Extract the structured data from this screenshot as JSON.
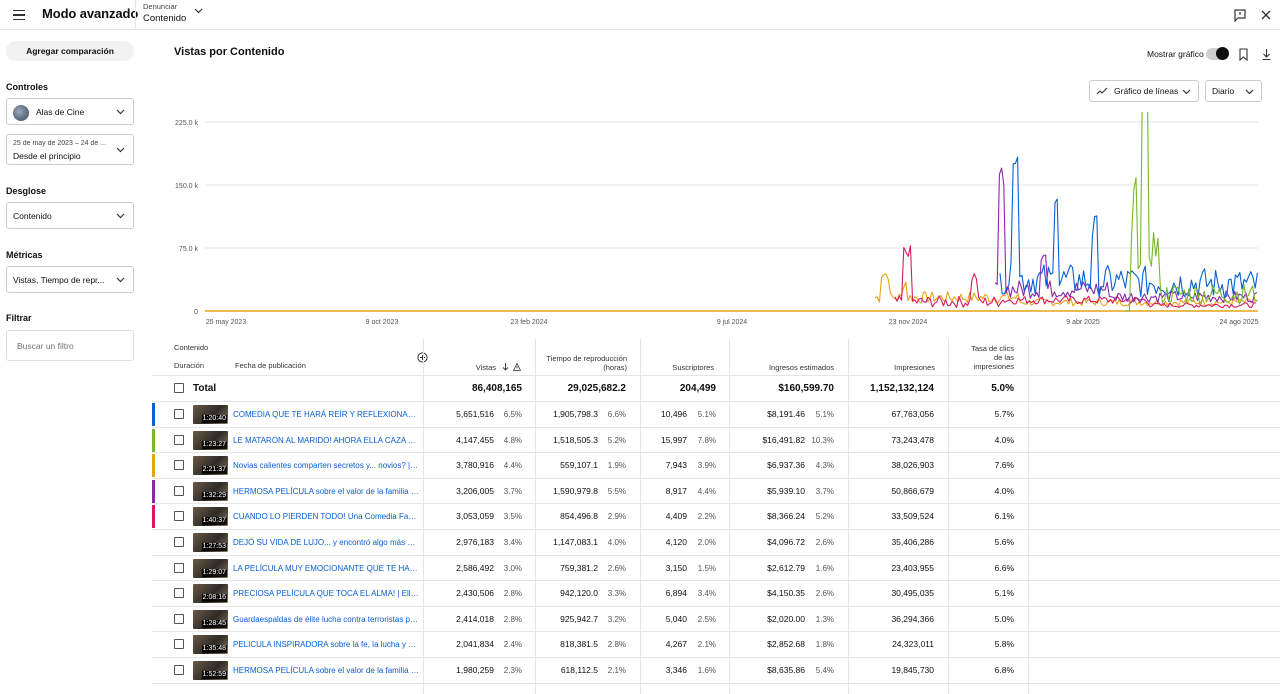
{
  "header": {
    "title": "Modo avanzado",
    "report_label": "Denunciar",
    "report_value": "Contenido"
  },
  "sidebar": {
    "add_comparison": "Agregar comparación",
    "controls_label": "Controles",
    "channel": "Alas de Cine",
    "date_range_top": "25 de may de 2023 – 24 de ...",
    "date_range": "Desde el principio",
    "breakdown_label": "Desglose",
    "breakdown_value": "Contenido",
    "metrics_label": "Métricas",
    "metrics_value": "Vistas, Tiempo de repr...",
    "filter_label": "Filtrar",
    "filter_placeholder": "Buscar un filtro"
  },
  "chart": {
    "title": "Vistas por Contenido",
    "show_graph_label": "Mostrar gráfico",
    "chart_type_label": "Gráfico de líneas",
    "granularity_label": "Diario"
  },
  "chart_data": {
    "type": "line",
    "x_ticks": [
      "25 may 2023",
      "9 oct 2023",
      "23 feb 2024",
      "9 jul 2024",
      "23 nov 2024",
      "9 abr 2025",
      "24 ago 2025"
    ],
    "y_ticks": [
      "0",
      "75.0 k",
      "150.0 k",
      "225.0 k"
    ],
    "ylim": [
      0,
      225000
    ],
    "series_colors": [
      "#065fd4",
      "#76b82a",
      "#e8a317",
      "#8e24aa",
      "#d81b60",
      "#ff8f00"
    ]
  },
  "table": {
    "headers": {
      "content": "Contenido",
      "duration": "Duración",
      "publish_date": "Fecha de publicación",
      "views": "Vistas",
      "watch_time": "Tiempo de reproducción (horas)",
      "subscribers": "Suscriptores",
      "revenue": "Ingresos estimados",
      "impressions": "Impresiones",
      "ctr": "Tasa de clics de las impresiones"
    },
    "total": {
      "label": "Total",
      "views": "86,408,165",
      "watch": "29,025,682.2",
      "subs": "204,499",
      "revenue": "$160,599.70",
      "impr": "1,152,132,124",
      "ctr": "5.0%"
    },
    "rows": [
      {
        "color": "#065fd4",
        "dur": "1:20:40",
        "title": "COMEDIA QUE TE HARÁ REÍR Y REFLEXIONAR ¿Segun...",
        "views": "5,651,516",
        "views_pct": "6.5%",
        "watch": "1,905,798.3",
        "watch_pct": "6.6%",
        "subs": "10,496",
        "subs_pct": "5.1%",
        "rev": "$8,191.46",
        "rev_pct": "5.1%",
        "impr": "67,763,056",
        "ctr": "5.7%"
      },
      {
        "color": "#76b82a",
        "dur": "1:23:27",
        "title": "LE MATARON AL MARIDO! AHORA ELLA CAZA A LOS ...",
        "views": "4,147,455",
        "views_pct": "4.8%",
        "watch": "1,518,505.3",
        "watch_pct": "5.2%",
        "subs": "15,997",
        "subs_pct": "7.8%",
        "rev": "$16,491.82",
        "rev_pct": "10.3%",
        "impr": "73,243,478",
        "ctr": "4.0%"
      },
      {
        "color": "#e8a317",
        "dur": "2:21:37",
        "title": "Novias calientes comparten secretos y... novios? | Peli...",
        "views": "3,780,916",
        "views_pct": "4.4%",
        "watch": "559,107.1",
        "watch_pct": "1.9%",
        "subs": "7,943",
        "subs_pct": "3.9%",
        "rev": "$6,937.36",
        "rev_pct": "4.3%",
        "impr": "38,026,903",
        "ctr": "7.6%"
      },
      {
        "color": "#8e24aa",
        "dur": "1:32:29",
        "title": "HERMOSA PELÍCULA sobre el valor de la familia y el p...",
        "views": "3,206,005",
        "views_pct": "3.7%",
        "watch": "1,590,979.8",
        "watch_pct": "5.5%",
        "subs": "8,917",
        "subs_pct": "4.4%",
        "rev": "$5,939.10",
        "rev_pct": "3.7%",
        "impr": "50,866,679",
        "ctr": "4.0%"
      },
      {
        "color": "#d81b60",
        "dur": "1:40:37",
        "title": "CUANDO LO PIERDEN TODO! Una Comedia Familiar pa...",
        "views": "3,053,059",
        "views_pct": "3.5%",
        "watch": "854,496.8",
        "watch_pct": "2.9%",
        "subs": "4,409",
        "subs_pct": "2.2%",
        "rev": "$8,366.24",
        "rev_pct": "5.2%",
        "impr": "33,509,524",
        "ctr": "6.1%"
      },
      {
        "color": "",
        "dur": "1:27:53",
        "title": "DEJÓ SU VIDA DE LUJO... y encontró algo más valioso ...",
        "views": "2,976,183",
        "views_pct": "3.4%",
        "watch": "1,147,083.1",
        "watch_pct": "4.0%",
        "subs": "4,120",
        "subs_pct": "2.0%",
        "rev": "$4,096.72",
        "rev_pct": "2.6%",
        "impr": "35,406,286",
        "ctr": "5.6%"
      },
      {
        "color": "",
        "dur": "1:29:07",
        "title": "LA PELÍCULA MUY EMOCIONANTE QUE TE HARÁ LLO...",
        "views": "2,586,492",
        "views_pct": "3.0%",
        "watch": "759,381.2",
        "watch_pct": "2.6%",
        "subs": "3,150",
        "subs_pct": "1.5%",
        "rev": "$2,612.79",
        "rev_pct": "1.6%",
        "impr": "23,403,955",
        "ctr": "6.6%"
      },
      {
        "color": "",
        "dur": "2:08:16",
        "title": "PRECIOSA PELÍCULA QUE TOCA EL ALMA! | Ella fue o...",
        "views": "2,430,506",
        "views_pct": "2.8%",
        "watch": "942,120.0",
        "watch_pct": "3.3%",
        "subs": "6,894",
        "subs_pct": "3.4%",
        "rev": "$4,150.35",
        "rev_pct": "2.6%",
        "impr": "30,495,035",
        "ctr": "5.1%"
      },
      {
        "color": "",
        "dur": "1:28:45",
        "title": "Guardaespaldas de élite lucha contra terroristas para s...",
        "views": "2,414,018",
        "views_pct": "2.8%",
        "watch": "925,942.7",
        "watch_pct": "3.2%",
        "subs": "5,040",
        "subs_pct": "2.5%",
        "rev": "$2,020.00",
        "rev_pct": "1.3%",
        "impr": "36,294,366",
        "ctr": "5.0%"
      },
      {
        "color": "",
        "dur": "1:35:48",
        "title": "PELICULA INSPIRADORA sobre la fe, la lucha y el sacri...",
        "views": "2,041,834",
        "views_pct": "2.4%",
        "watch": "818,381.5",
        "watch_pct": "2.8%",
        "subs": "4,267",
        "subs_pct": "2.1%",
        "rev": "$2,852.68",
        "rev_pct": "1.8%",
        "impr": "24,323,011",
        "ctr": "5.8%"
      },
      {
        "color": "",
        "dur": "1:52:59",
        "title": "HERMOSA PELÍCULA sobre el valor de la familia y los ...",
        "views": "1,980,259",
        "views_pct": "2.3%",
        "watch": "618,112.5",
        "watch_pct": "2.1%",
        "subs": "3,346",
        "subs_pct": "1.6%",
        "rev": "$8,635.86",
        "rev_pct": "5.4%",
        "impr": "19,845,730",
        "ctr": "6.8%"
      }
    ]
  }
}
